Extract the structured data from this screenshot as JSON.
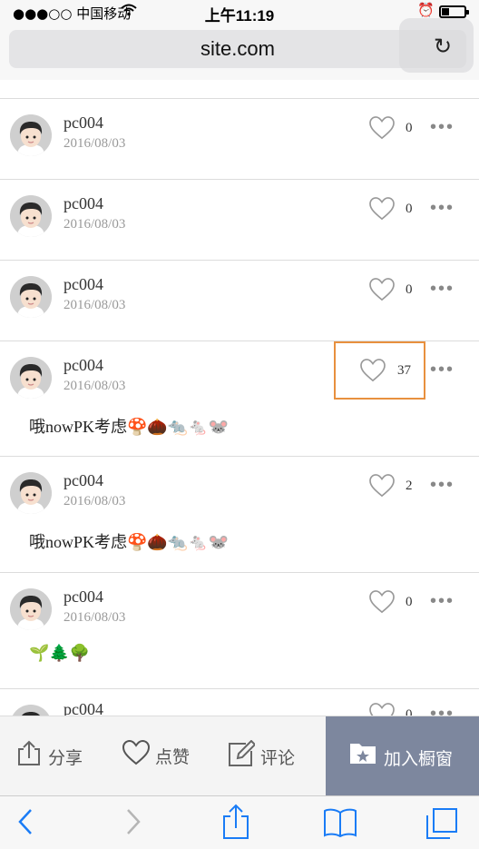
{
  "status": {
    "carrier": "●●●○○ 中国移动",
    "time": "上午11:19",
    "battery_level": 0.35
  },
  "browser": {
    "url": "site.com"
  },
  "posts": [
    {
      "user": "pc004",
      "date": "2016/08/03",
      "likes": "0",
      "text": ""
    },
    {
      "user": "pc004",
      "date": "2016/08/03",
      "likes": "0",
      "text": ""
    },
    {
      "user": "pc004",
      "date": "2016/08/03",
      "likes": "0",
      "text": ""
    },
    {
      "user": "pc004",
      "date": "2016/08/03",
      "likes": "37",
      "text": "哦nowPK考虑🍄🌰🐀🐁🐭"
    },
    {
      "user": "pc004",
      "date": "2016/08/03",
      "likes": "2",
      "text": "哦nowPK考虑🍄🌰🐀🐁🐭"
    },
    {
      "user": "pc004",
      "date": "2016/08/03",
      "likes": "0",
      "text": "🌱🌲🌳"
    },
    {
      "user": "pc004",
      "date": "",
      "likes": "0",
      "text": ""
    }
  ],
  "actions": {
    "share": "分享",
    "like": "点赞",
    "comment": "评论",
    "add_window": "加入橱窗"
  },
  "colors": {
    "highlight": "#e8903e",
    "add_window_bg": "#7d879e",
    "ios_blue": "#1a7cf6"
  }
}
